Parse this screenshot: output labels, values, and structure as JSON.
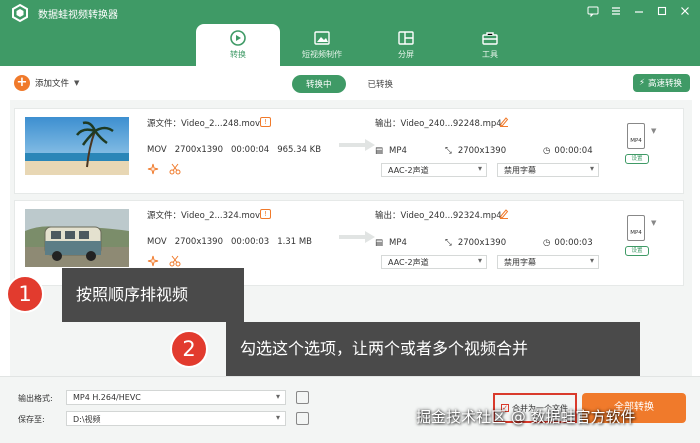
{
  "app": {
    "title": "数据蛙视频转换器"
  },
  "nav": {
    "tabs": [
      {
        "label": "转换",
        "active": true
      },
      {
        "label": "短视频制作",
        "active": false
      },
      {
        "label": "分屏",
        "active": false
      },
      {
        "label": "工具",
        "active": false
      }
    ]
  },
  "toolbar": {
    "add_label": "添加文件",
    "converting_label": "转换中",
    "converted_label": "已转换",
    "fast_label": "高速转换"
  },
  "files": [
    {
      "source": "源文件：Video_2...248.mov",
      "format": "MOV",
      "resolution": "2700x1390",
      "duration": "00:00:04",
      "size": "965.34 KB",
      "output_name": "输出：Video_240...92248.mp4",
      "out_format": "MP4",
      "out_resolution": "2700x1390",
      "out_duration": "00:00:04",
      "audio": "AAC-2声道",
      "subtitle": "禁用字幕",
      "badge": "MP4",
      "settings": "设置"
    },
    {
      "source": "源文件：Video_2...324.mov",
      "format": "MOV",
      "resolution": "2700x1390",
      "duration": "00:00:03",
      "size": "1.31 MB",
      "output_name": "输出：Video_240...92324.mp4",
      "out_format": "MP4",
      "out_resolution": "2700x1390",
      "out_duration": "00:00:03",
      "audio": "AAC-2声道",
      "subtitle": "禁用字幕",
      "badge": "MP4",
      "settings": "设置"
    }
  ],
  "callouts": [
    {
      "number": "1",
      "text": "按照顺序排视频"
    },
    {
      "number": "2",
      "text": "勾选这个选项，让两个或者多个视频合并"
    }
  ],
  "bottom": {
    "format_label": "输出格式:",
    "format_value": "MP4 H.264/HEVC",
    "save_label": "保存至:",
    "save_value": "D:\\视频",
    "merge_label": "合并为一个文件",
    "convert_all": "全部转换"
  },
  "watermark": "掘金技术社区 @ 数据蛙官方软件",
  "colors": {
    "brand": "#3f9a66",
    "accent": "#f07a2b",
    "callout": "#e23b2e"
  }
}
